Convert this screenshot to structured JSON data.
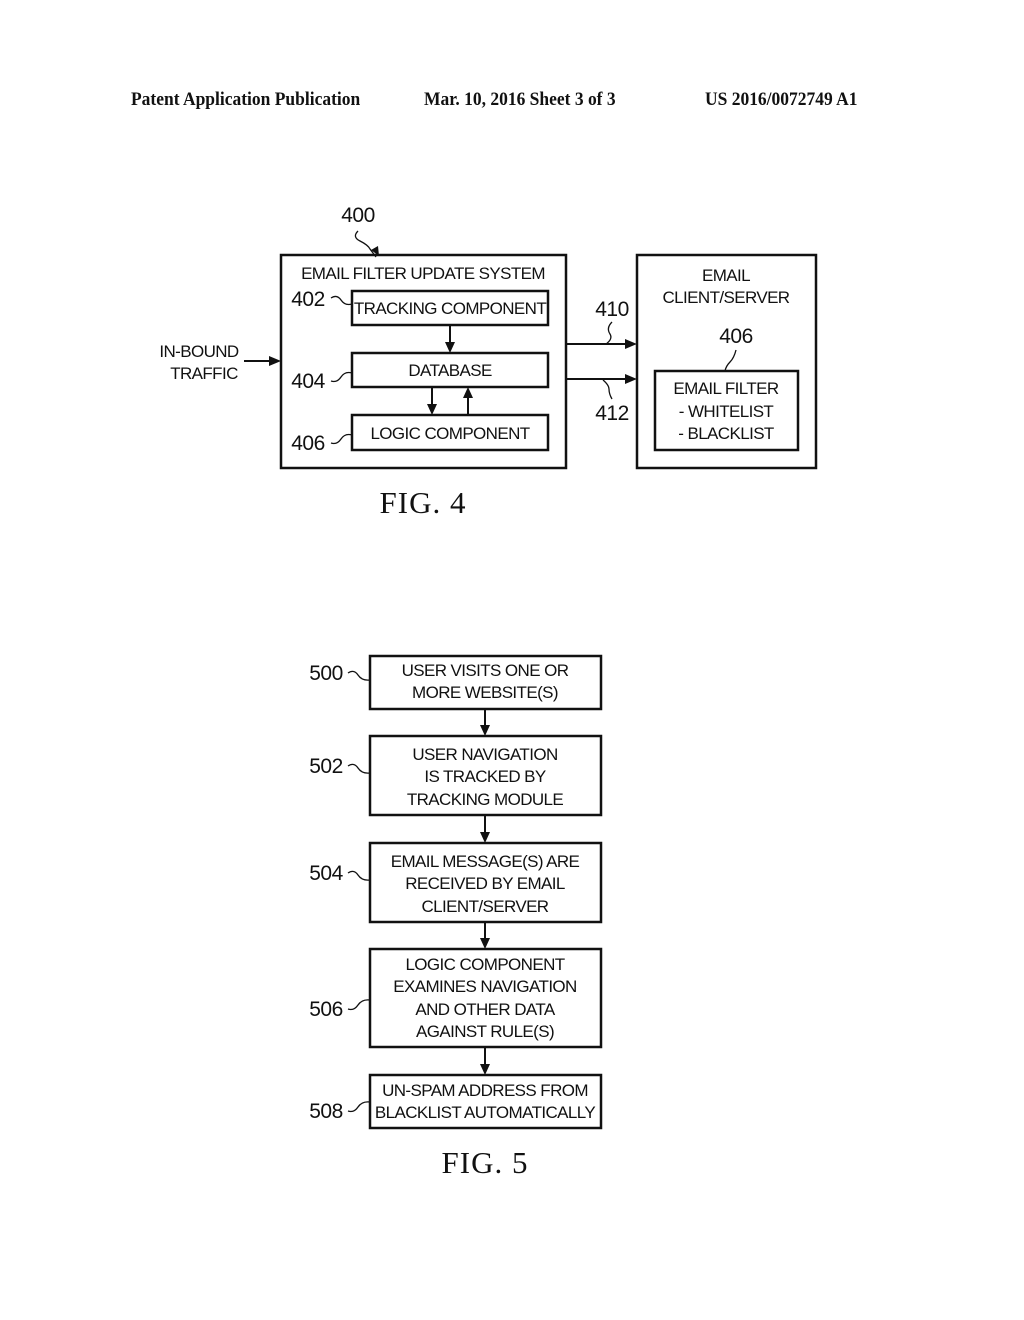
{
  "header": {
    "publication": "Patent Application Publication",
    "date_sheet": "Mar. 10, 2016  Sheet 3 of 3",
    "patent_number": "US 2016/0072749 A1"
  },
  "fig4": {
    "caption": "FIG. 4",
    "system_ref": "400",
    "inbound": [
      "IN-BOUND",
      "TRAFFIC"
    ],
    "system": {
      "title": "EMAIL FILTER UPDATE SYSTEM",
      "components": [
        {
          "ref": "402",
          "label": "TRACKING COMPONENT"
        },
        {
          "ref": "404",
          "label": "DATABASE"
        },
        {
          "ref": "406",
          "label": "LOGIC COMPONENT"
        }
      ]
    },
    "connections": [
      {
        "ref": "410"
      },
      {
        "ref": "412"
      }
    ],
    "client": {
      "title": [
        "EMAIL",
        "CLIENT/SERVER"
      ],
      "filter_ref": "406",
      "filter_lines": [
        "EMAIL FILTER",
        "- WHITELIST",
        "- BLACKLIST"
      ]
    }
  },
  "fig5": {
    "caption": "FIG. 5",
    "steps": [
      {
        "ref": "500",
        "lines": [
          "USER VISITS ONE OR",
          "MORE WEBSITE(S)"
        ]
      },
      {
        "ref": "502",
        "lines": [
          "USER NAVIGATION",
          "IS TRACKED BY",
          "TRACKING MODULE"
        ]
      },
      {
        "ref": "504",
        "lines": [
          "EMAIL MESSAGE(S) ARE",
          "RECEIVED BY EMAIL",
          "CLIENT/SERVER"
        ]
      },
      {
        "ref": "506",
        "lines": [
          "LOGIC COMPONENT",
          "EXAMINES NAVIGATION",
          "AND OTHER DATA",
          "AGAINST RULE(S)"
        ]
      },
      {
        "ref": "508",
        "lines": [
          "UN-SPAM ADDRESS FROM",
          "BLACKLIST AUTOMATICALLY"
        ]
      }
    ]
  }
}
